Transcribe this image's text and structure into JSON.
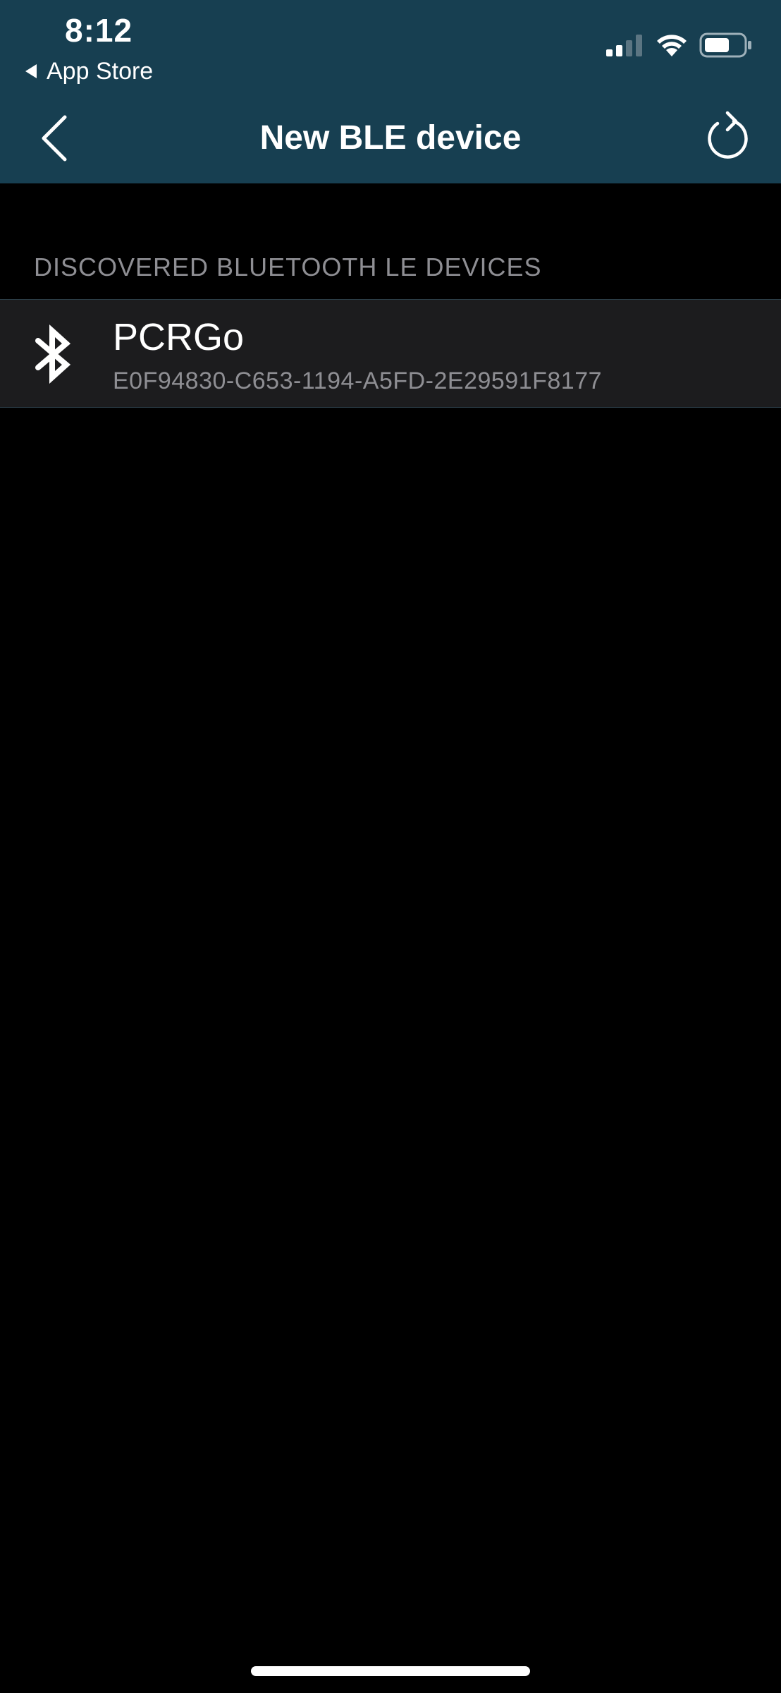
{
  "status_bar": {
    "time": "8:12",
    "back_app_label": "App Store",
    "signal_icon": "cellular-signal-icon",
    "wifi_icon": "wifi-icon",
    "battery_icon": "battery-icon"
  },
  "nav": {
    "title": "New BLE device",
    "back_icon": "chevron-left-icon",
    "refresh_icon": "refresh-icon"
  },
  "section": {
    "header": "DISCOVERED BLUETOOTH LE DEVICES"
  },
  "devices": [
    {
      "name": "PCRGo",
      "uuid": "E0F94830-C653-1194-A5FD-2E29591F8177",
      "icon": "bluetooth-icon"
    }
  ],
  "colors": {
    "nav_background": "#173f51",
    "page_background": "#000000",
    "row_background": "#1c1c1e",
    "secondary_text": "#8e8e93"
  }
}
